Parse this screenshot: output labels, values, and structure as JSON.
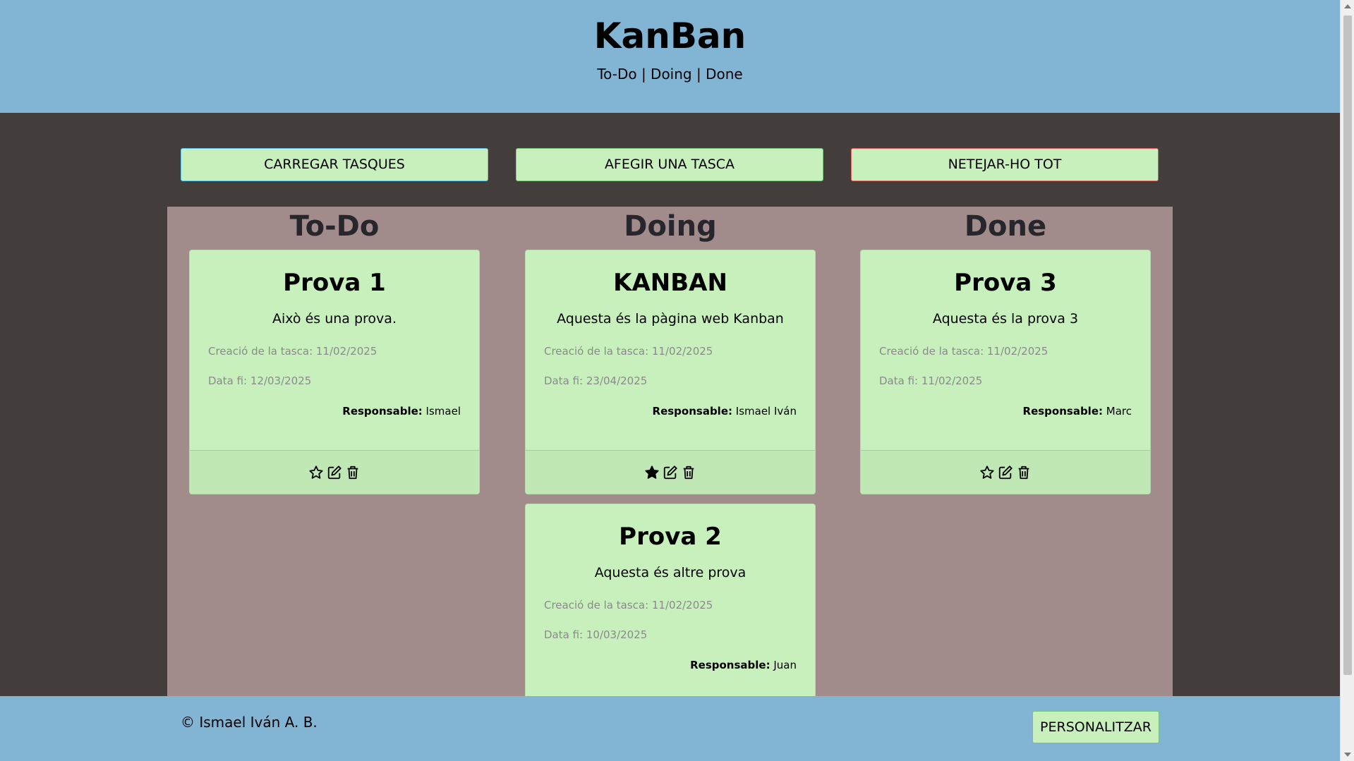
{
  "header": {
    "title": "KanBan",
    "subtitle": "To-Do | Doing | Done"
  },
  "actions": {
    "load_label": "CARREGAR TASQUES",
    "add_label": "AFEGIR UNA TASCA",
    "clear_label": "NETEJAR-HO TOT"
  },
  "columns": [
    {
      "title": "To-Do",
      "cards": [
        {
          "title": "Prova 1",
          "text": "Això és una prova.",
          "created": "Creació de la tasca: 11/02/2025",
          "end": "Data fi: 12/03/2025",
          "owner_label": "Responsable:",
          "owner": "Ismael",
          "starred": false
        }
      ]
    },
    {
      "title": "Doing",
      "cards": [
        {
          "title": "KANBAN",
          "text": "Aquesta és la pàgina web Kanban",
          "created": "Creació de la tasca: 11/02/2025",
          "end": "Data fi: 23/04/2025",
          "owner_label": "Responsable:",
          "owner": "Ismael Iván",
          "starred": true
        },
        {
          "title": "Prova 2",
          "text": "Aquesta és altre prova",
          "created": "Creació de la tasca: 11/02/2025",
          "end": "Data fi: 10/03/2025",
          "owner_label": "Responsable:",
          "owner": "Juan",
          "starred": false
        }
      ]
    },
    {
      "title": "Done",
      "cards": [
        {
          "title": "Prova 3",
          "text": "Aquesta és la prova 3",
          "created": "Creació de la tasca: 11/02/2025",
          "end": "Data fi: 11/02/2025",
          "owner_label": "Responsable:",
          "owner": "Marc",
          "starred": false
        }
      ]
    }
  ],
  "icons": {
    "star": "star-icon",
    "edit": "edit-icon",
    "delete": "trash-icon"
  },
  "footer": {
    "copyright": "© Ismael Iván A. B.",
    "customize_label": "PERSONALITZAR"
  },
  "colors": {
    "header_bg": "#82b4d4",
    "page_bg": "#433d3b",
    "board_bg": "#a28b8b",
    "card_bg": "#c8f0bd"
  }
}
